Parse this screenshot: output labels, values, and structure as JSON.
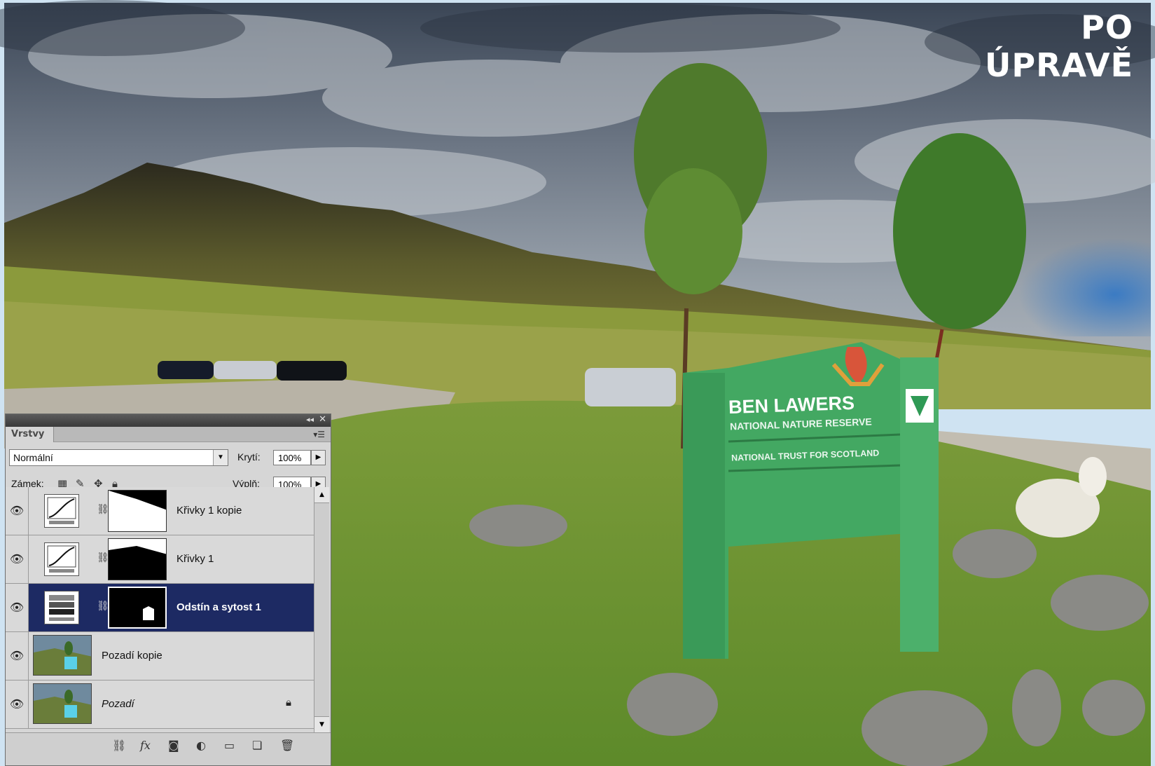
{
  "photo": {
    "caption": "PO ÚPRAVĚ",
    "sign": {
      "title": "BEN LAWERS",
      "subtitle": "NATIONAL NATURE RESERVE",
      "org": "NATIONAL TRUST FOR SCOTLAND"
    }
  },
  "layers_panel": {
    "tab": "Vrstvy",
    "blend_mode": "Normální",
    "opacity_label": "Krytí:",
    "opacity_value": "100%",
    "lock_label": "Zámek:",
    "fill_label": "Výplň:",
    "fill_value": "100%",
    "layers": [
      {
        "name": "Křivky 1 kopie",
        "type": "curves"
      },
      {
        "name": "Křivky 1",
        "type": "curves"
      },
      {
        "name": "Odstín a sytost 1",
        "type": "hue-saturation",
        "selected": true
      },
      {
        "name": "Pozadí kopie",
        "type": "image"
      },
      {
        "name": "Pozadí",
        "type": "image",
        "locked": true
      }
    ]
  },
  "colors": {
    "selected_layer": "#1d2a63",
    "sign_green": "#3ea45e",
    "sky_blue": "#2f6fb3"
  }
}
